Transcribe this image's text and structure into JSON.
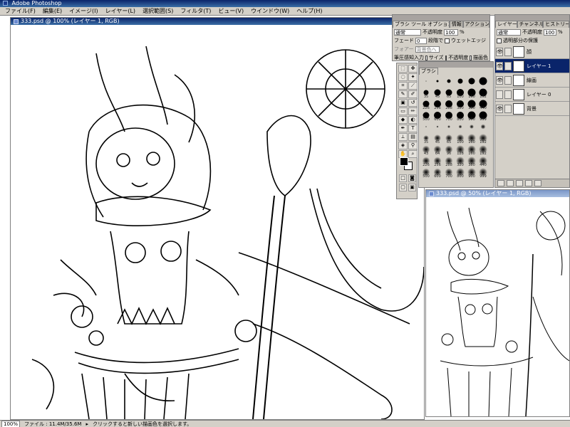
{
  "app": {
    "title": "Adobe Photoshop"
  },
  "menu": [
    "ファイル(F)",
    "編集(E)",
    "イメージ(I)",
    "レイヤー(L)",
    "選択範囲(S)",
    "フィルタ(T)",
    "ビュー(V)",
    "ウインドウ(W)",
    "ヘルプ(H)"
  ],
  "document": {
    "title": "333.psd @ 100% (レイヤー 1, RGB)"
  },
  "preview": {
    "title": "333.psd @ 50% (レイヤー 1, RGB)"
  },
  "brush_options": {
    "tabs": [
      "ブラシ ツール オプション",
      "情報",
      "アクション"
    ],
    "mode": "通常",
    "opacity_label": "不透明度",
    "opacity_value": "100",
    "fade_label": "フェード",
    "fade_value": "0",
    "steps_label": "段階で",
    "wet_edge_label": "ウェットエッジ",
    "fade_to_label": "フォアー",
    "fade_to_value": "背景色へ",
    "pressure_label": "筆圧感知入力",
    "size_label": "サイズ",
    "opacity_check_label": "不透明度",
    "color_label": "描画色"
  },
  "brushes": {
    "tabs": [
      "ブラシ"
    ],
    "cells": [
      {
        "kind": "hard",
        "d": 1,
        "lbl": ""
      },
      {
        "kind": "hard",
        "d": 3,
        "lbl": ""
      },
      {
        "kind": "hard",
        "d": 5,
        "lbl": ""
      },
      {
        "kind": "hard",
        "d": 7,
        "lbl": ""
      },
      {
        "kind": "hard",
        "d": 9,
        "lbl": ""
      },
      {
        "kind": "hard",
        "d": 11,
        "lbl": ""
      },
      {
        "kind": "hard",
        "d": 7,
        "lbl": "35"
      },
      {
        "kind": "hard",
        "d": 9,
        "lbl": "45"
      },
      {
        "kind": "hard",
        "d": 9,
        "lbl": "65"
      },
      {
        "kind": "hard",
        "d": 10,
        "lbl": "100"
      },
      {
        "kind": "hard",
        "d": 11,
        "lbl": "160"
      },
      {
        "kind": "hard",
        "d": 11,
        "lbl": "192"
      },
      {
        "kind": "hard",
        "d": 9,
        "lbl": "226"
      },
      {
        "kind": "hard",
        "d": 10,
        "lbl": "256"
      },
      {
        "kind": "hard",
        "d": 10,
        "lbl": "288"
      },
      {
        "kind": "hard",
        "d": 10,
        "lbl": "320"
      },
      {
        "kind": "hard",
        "d": 11,
        "lbl": "380"
      },
      {
        "kind": "hard",
        "d": 11,
        "lbl": "440"
      },
      {
        "kind": "hard",
        "d": 9,
        "lbl": "500"
      },
      {
        "kind": "hard",
        "d": 10,
        "lbl": "600"
      },
      {
        "kind": "hard",
        "d": 10,
        "lbl": "700"
      },
      {
        "kind": "hard",
        "d": 10,
        "lbl": "800"
      },
      {
        "kind": "hard",
        "d": 11,
        "lbl": "900"
      },
      {
        "kind": "hard",
        "d": 11,
        "lbl": "999"
      },
      {
        "kind": "soft",
        "d": 2,
        "lbl": ""
      },
      {
        "kind": "soft",
        "d": 3,
        "lbl": ""
      },
      {
        "kind": "soft",
        "d": 4,
        "lbl": ""
      },
      {
        "kind": "soft",
        "d": 5,
        "lbl": ""
      },
      {
        "kind": "soft",
        "d": 6,
        "lbl": ""
      },
      {
        "kind": "soft",
        "d": 7,
        "lbl": ""
      },
      {
        "kind": "soft",
        "d": 8,
        "lbl": "35"
      },
      {
        "kind": "soft",
        "d": 10,
        "lbl": "45"
      },
      {
        "kind": "soft",
        "d": 10,
        "lbl": "65"
      },
      {
        "kind": "soft",
        "d": 11,
        "lbl": "100"
      },
      {
        "kind": "soft",
        "d": 12,
        "lbl": "160"
      },
      {
        "kind": "soft",
        "d": 12,
        "lbl": "192"
      },
      {
        "kind": "soft",
        "d": 11,
        "lbl": "43"
      },
      {
        "kind": "soft",
        "d": 11,
        "lbl": "64"
      },
      {
        "kind": "soft",
        "d": 11,
        "lbl": "96"
      },
      {
        "kind": "soft",
        "d": 12,
        "lbl": "128"
      },
      {
        "kind": "soft",
        "d": 12,
        "lbl": "160"
      },
      {
        "kind": "soft",
        "d": 12,
        "lbl": "192"
      },
      {
        "kind": "soft",
        "d": 11,
        "lbl": "226"
      },
      {
        "kind": "soft",
        "d": 11,
        "lbl": "256"
      },
      {
        "kind": "soft",
        "d": 11,
        "lbl": "288"
      },
      {
        "kind": "soft",
        "d": 12,
        "lbl": "320"
      },
      {
        "kind": "soft",
        "d": 12,
        "lbl": "380"
      },
      {
        "kind": "soft",
        "d": 12,
        "lbl": "440"
      },
      {
        "kind": "soft",
        "d": 11,
        "lbl": "500"
      },
      {
        "kind": "soft",
        "d": 11,
        "lbl": "600"
      },
      {
        "kind": "soft",
        "d": 11,
        "lbl": "700"
      },
      {
        "kind": "soft",
        "d": 12,
        "lbl": "800"
      },
      {
        "kind": "soft",
        "d": 12,
        "lbl": "900"
      },
      {
        "kind": "soft",
        "d": 12,
        "lbl": "999"
      }
    ]
  },
  "layers": {
    "tabs": [
      "レイヤー",
      "チャンネル",
      "ヒストリー"
    ],
    "mode": "通常",
    "opacity_label": "不透明度",
    "opacity_value": "100",
    "preserve_label": "透明部分の保護",
    "items": [
      {
        "name": "顔",
        "active": false,
        "eye": true
      },
      {
        "name": "レイヤー 1",
        "active": true,
        "eye": true
      },
      {
        "name": "線画",
        "active": false,
        "eye": true
      },
      {
        "name": "レイヤー 0",
        "active": false,
        "eye": false
      },
      {
        "name": "背景",
        "active": false,
        "eye": true
      }
    ]
  },
  "status": {
    "zoom": "100%",
    "file_info": "ファイル : 11.4M/35.6M",
    "hint": "クリックすると新しい描画色を選択します。"
  },
  "colors": {
    "title_bar": "#0a246a",
    "chrome": "#d4d0c8",
    "foreground": "#000000",
    "background": "#ffffff"
  }
}
